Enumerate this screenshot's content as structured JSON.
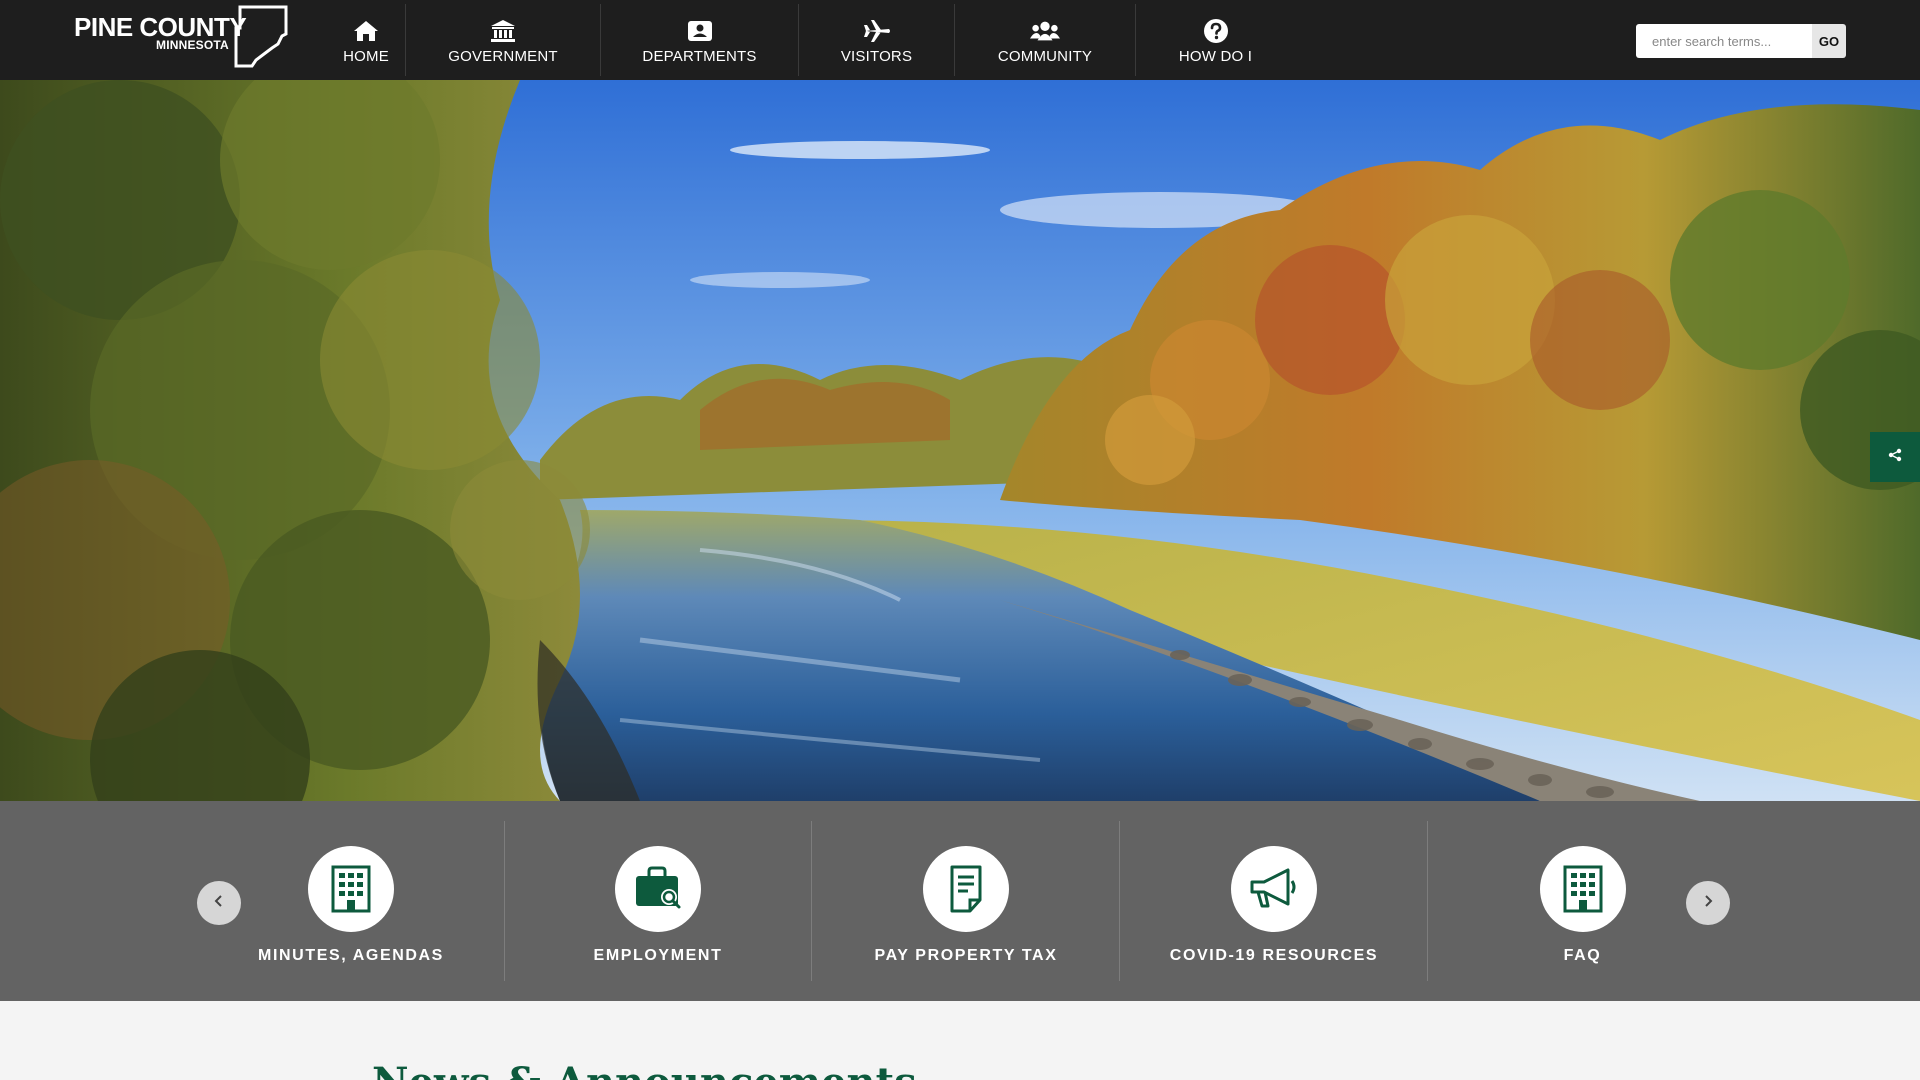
{
  "header": {
    "logo": {
      "title": "PINE COUNTY",
      "subtitle": "MINNESOTA"
    },
    "nav": [
      {
        "label": "HOME",
        "icon": "home-icon"
      },
      {
        "label": "GOVERNMENT",
        "icon": "capitol-building-icon"
      },
      {
        "label": "DEPARTMENTS",
        "icon": "contact-card-icon"
      },
      {
        "label": "VISITORS",
        "icon": "airplane-icon"
      },
      {
        "label": "COMMUNITY",
        "icon": "people-group-icon"
      },
      {
        "label": "HOW DO I",
        "icon": "question-circle-icon"
      }
    ],
    "search": {
      "placeholder": "enter search terms...",
      "go_label": "GO"
    }
  },
  "share": {
    "icon": "share-icon"
  },
  "quick_links": {
    "items": [
      {
        "label": "MINUTES, AGENDAS",
        "icon": "building-icon"
      },
      {
        "label": "EMPLOYMENT",
        "icon": "briefcase-search-icon"
      },
      {
        "label": "PAY PROPERTY TAX",
        "icon": "document-icon"
      },
      {
        "label": "COVID-19 RESOURCES",
        "icon": "megaphone-icon"
      },
      {
        "label": "FAQ",
        "icon": "building-icon"
      }
    ],
    "prev_icon": "chevron-left-icon",
    "next_icon": "chevron-right-icon"
  },
  "news": {
    "title": "News & Announcements"
  },
  "colors": {
    "header_bg": "#1e1e1e",
    "accent_green": "#0d5a3d",
    "quicklinks_bg": "#636363",
    "page_bg": "#f4f4f4"
  }
}
